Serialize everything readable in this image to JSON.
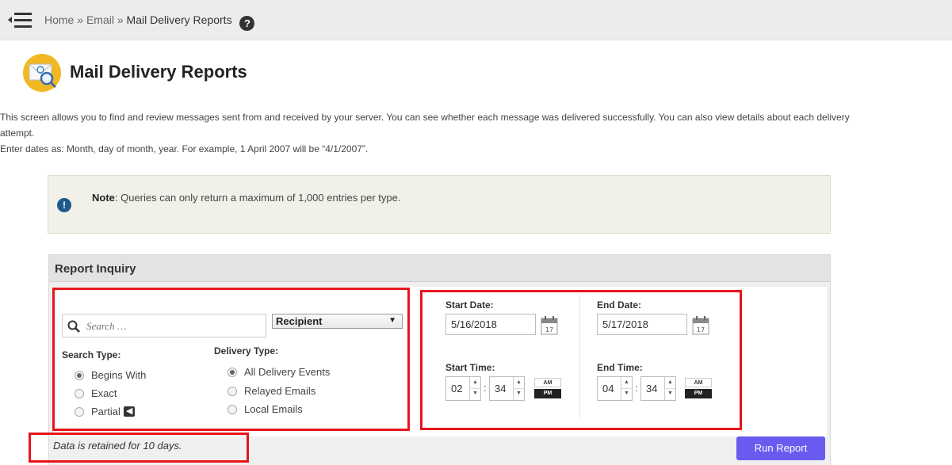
{
  "colors": {
    "accent": "#6a5bf0",
    "highlight": "#e8141c",
    "topbar": "#ececec"
  },
  "topbar": {
    "menu_icon": "hamburger-collapse-icon",
    "breadcrumb": {
      "home": "Home",
      "sep1": "»",
      "email": "Email",
      "sep2": "»",
      "current": "Mail Delivery Reports"
    },
    "help_icon": "question-circle-icon",
    "help_symbol": "?"
  },
  "page": {
    "icon": "mail-search-icon",
    "title": "Mail Delivery Reports",
    "description_line1": "This screen allows you to find and review messages sent from and received by your server. You can see whether each message was delivered successfully. You can also view details about each delivery",
    "description_line2": "attempt.",
    "description_line3": "Enter dates as: Month, day of month, year. For example, 1 April 2007 will be “4/1/2007”."
  },
  "note": {
    "icon": "info-circle-icon",
    "icon_symbol": "!",
    "label": "Note",
    "text": ": Queries can only return a maximum of 1,000 entries per type."
  },
  "report": {
    "title": "Report Inquiry",
    "search": {
      "placeholder": "Search …",
      "value": ""
    },
    "field_select": {
      "selected": "Recipient",
      "arrow": "▼"
    },
    "search_type": {
      "label": "Search Type:",
      "options": [
        "Begins With",
        "Exact",
        "Partial"
      ],
      "selected": "Begins With",
      "partial_icon": "tag-icon"
    },
    "delivery_type": {
      "label": "Delivery Type:",
      "options": [
        "All Delivery Events",
        "Relayed Emails",
        "Local Emails"
      ],
      "selected": "All Delivery Events"
    },
    "start_date": {
      "label": "Start Date:",
      "value": "5/16/2018",
      "calendar_day": "17"
    },
    "end_date": {
      "label": "End Date:",
      "value": "5/17/2018",
      "calendar_day": "17"
    },
    "start_time": {
      "label": "Start Time:",
      "hour": "02",
      "minute": "34",
      "am": "AM",
      "pm": "PM",
      "period": "PM"
    },
    "end_time": {
      "label": "End Time:",
      "hour": "04",
      "minute": "34",
      "am": "AM",
      "pm": "PM",
      "period": "PM"
    },
    "time_separator": ":",
    "retention": "Data is retained for 10 days.",
    "run_button": "Run Report"
  }
}
